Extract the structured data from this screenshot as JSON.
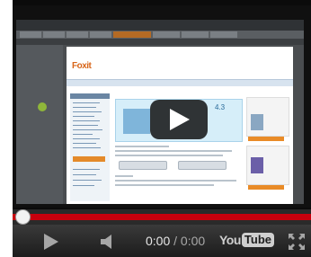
{
  "player": {
    "current_time": "0:00",
    "separator": "/",
    "duration": "0:00",
    "logo_you": "You",
    "logo_tube": "Tube",
    "progress_fraction": 0
  },
  "video_frame": {
    "brand_name": "Foxit",
    "banner_version": "4.3"
  },
  "icons": {
    "big_play": "play-icon",
    "play": "play-icon",
    "volume": "volume-icon",
    "fullscreen": "fullscreen-icon"
  },
  "colors": {
    "progress": "#c8000d",
    "controls_bg": "#1c1c1c",
    "brand": "#d8661a"
  }
}
